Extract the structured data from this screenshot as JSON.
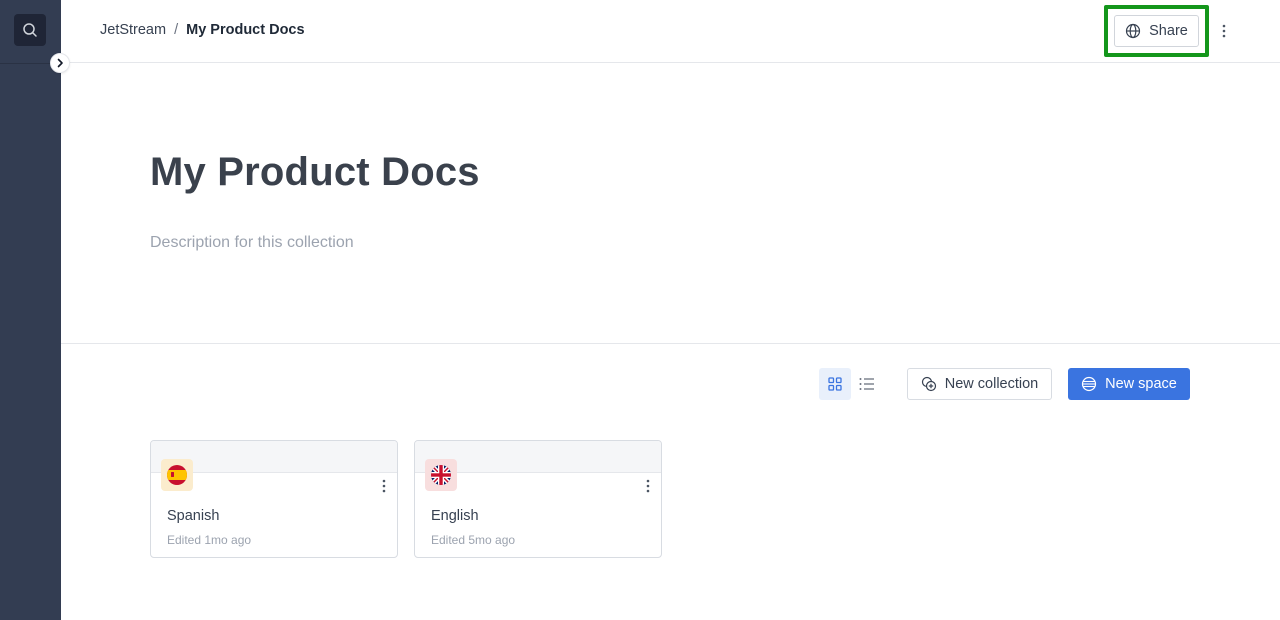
{
  "breadcrumb": {
    "parent": "JetStream",
    "separator": "/",
    "current": "My Product Docs"
  },
  "header": {
    "share_label": "Share"
  },
  "collection": {
    "title": "My Product Docs",
    "description": "Description for this collection"
  },
  "toolbar": {
    "new_collection_label": "New collection",
    "new_space_label": "New space"
  },
  "cards": [
    {
      "name": "Spanish",
      "edited": "Edited 1mo ago",
      "flag": "spain-flag-icon"
    },
    {
      "name": "English",
      "edited": "Edited 5mo ago",
      "flag": "uk-flag-icon"
    }
  ],
  "icons": {
    "sidebar_search": "search-icon",
    "expand": "chevron-right-icon",
    "share": "globe-icon",
    "more": "more-vertical-icon",
    "grid_view": "grid-icon",
    "list_view": "list-icon",
    "new_collection": "collection-icon",
    "new_space": "globe-icon"
  },
  "colors": {
    "sidebar": "#333d52",
    "accent": "#3a74e0",
    "highlight": "#14961b"
  }
}
